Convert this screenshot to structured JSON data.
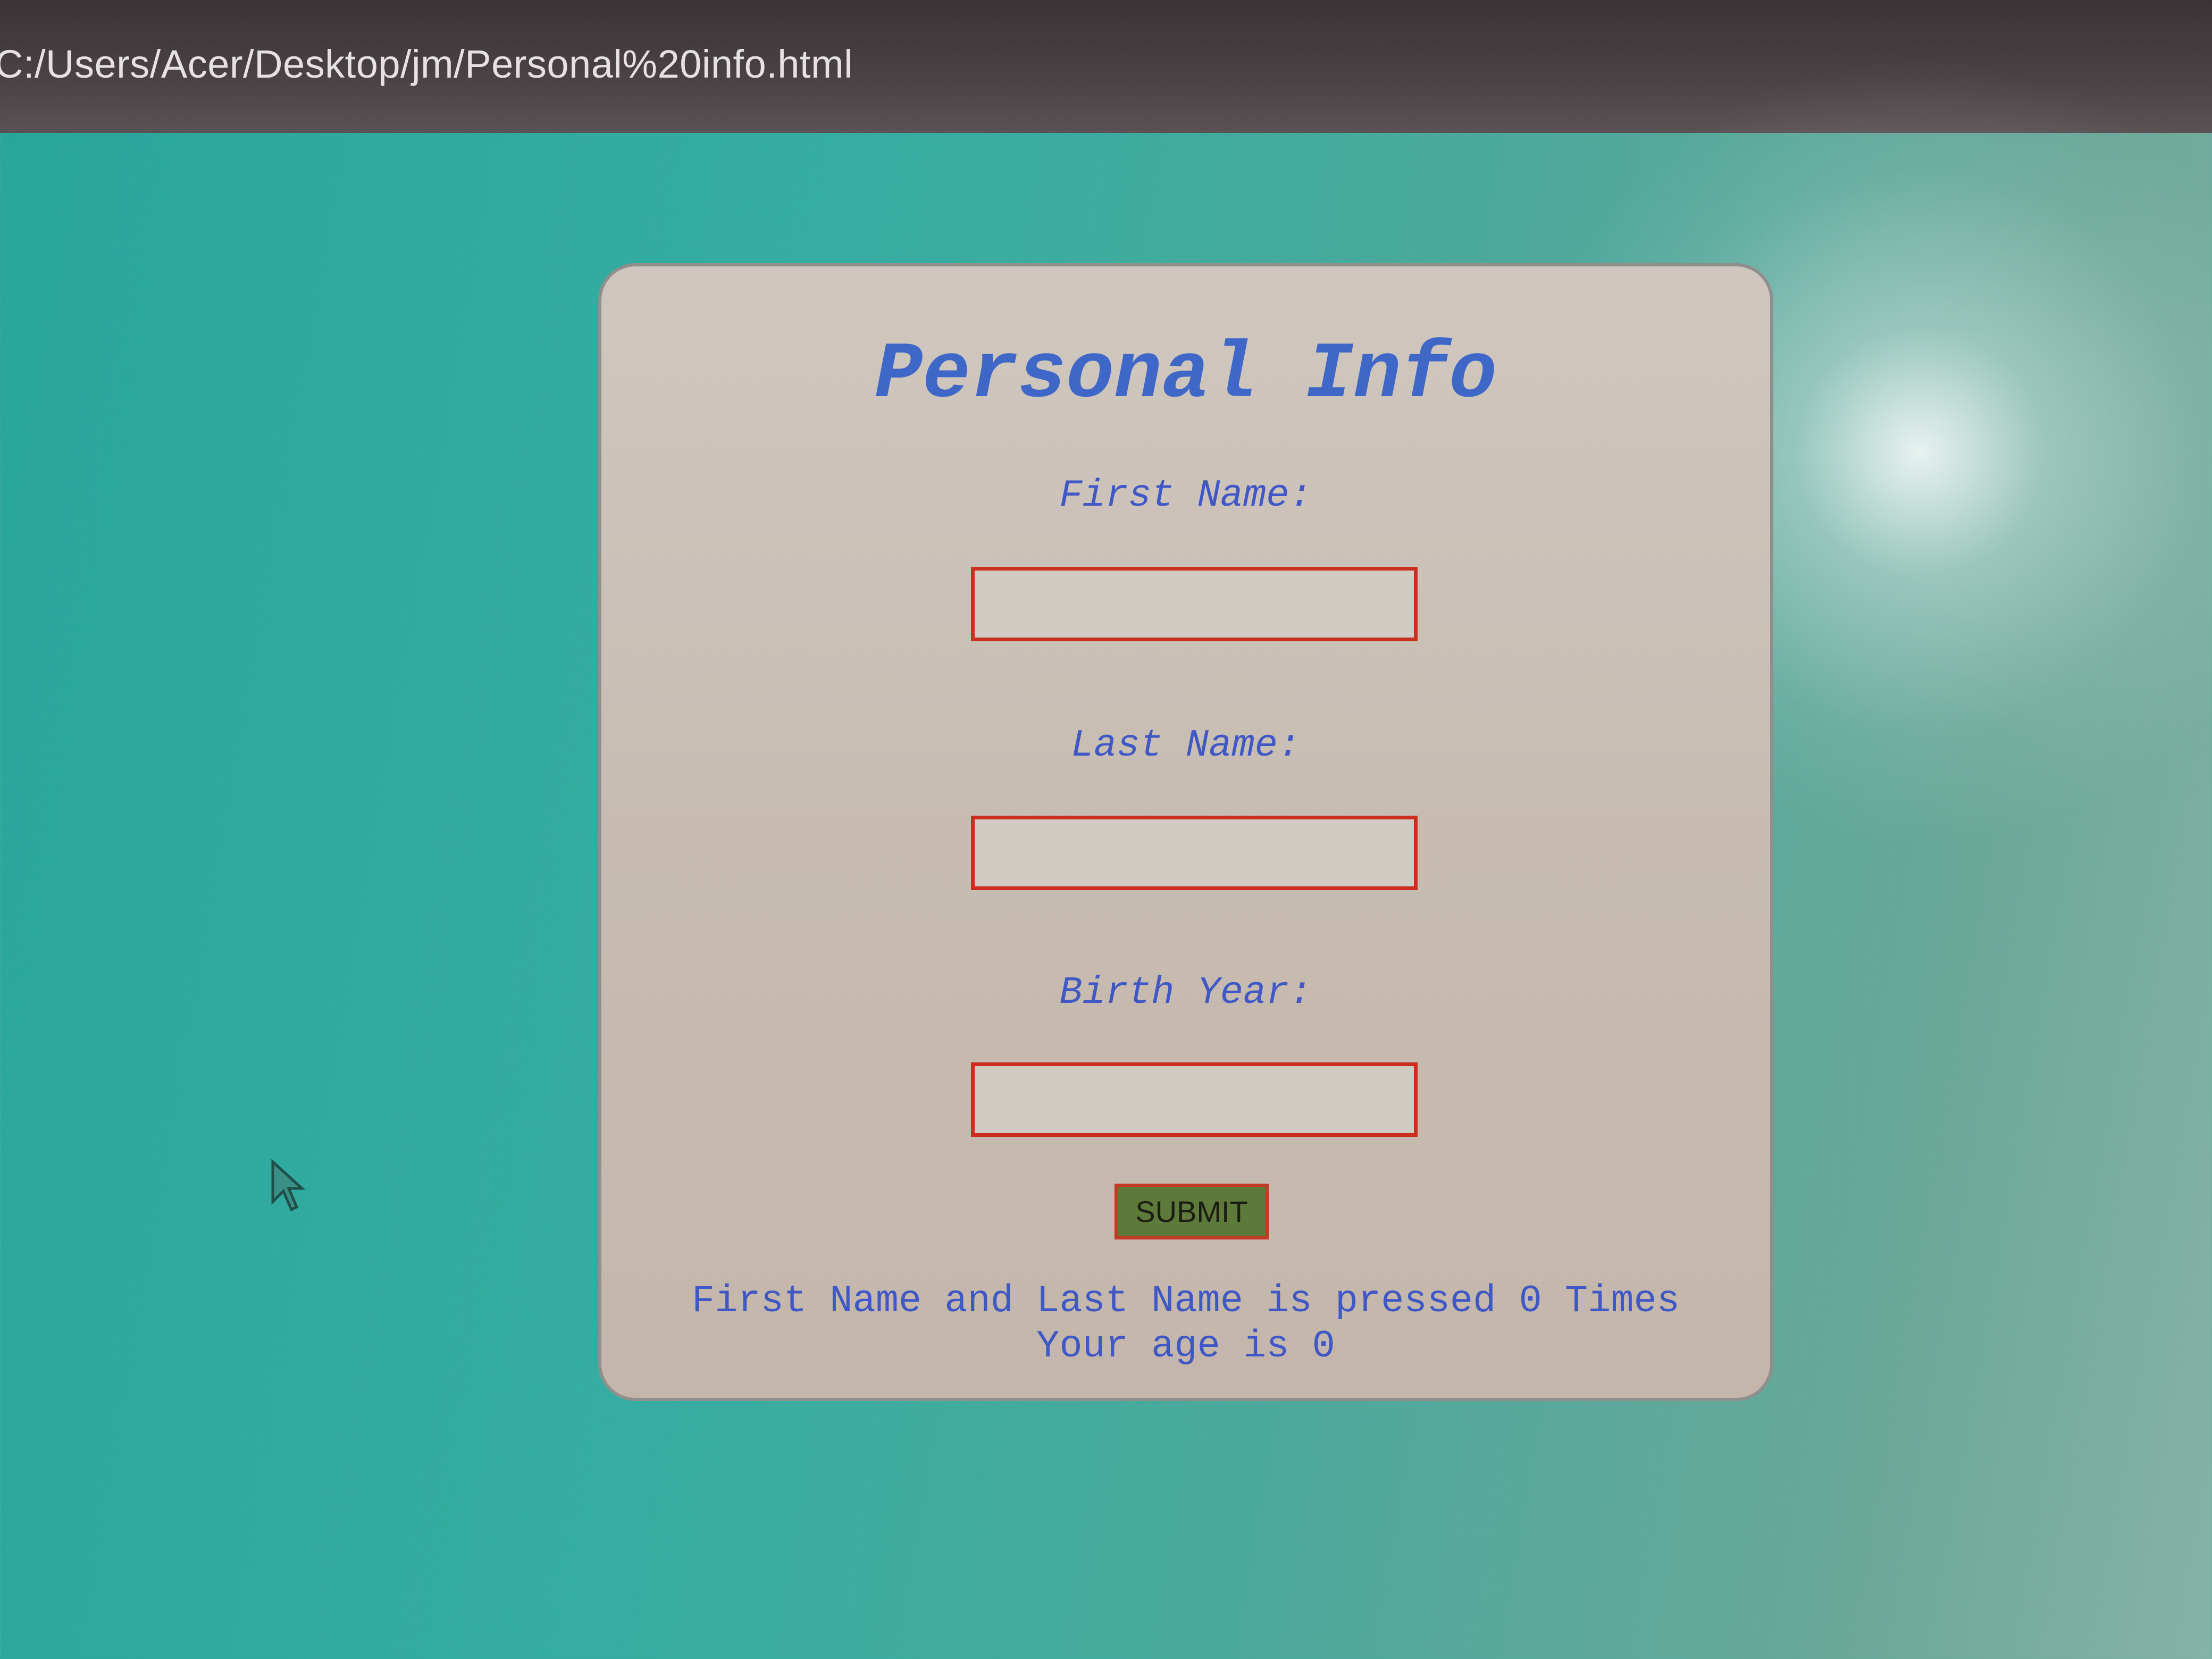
{
  "browser": {
    "address": "C:/Users/Acer/Desktop/jm/Personal%20info.html"
  },
  "form": {
    "title": "Personal Info",
    "fields": [
      {
        "label": "First Name:",
        "value": ""
      },
      {
        "label": "Last Name:",
        "value": ""
      },
      {
        "label": "Birth Year:",
        "value": ""
      }
    ],
    "submit_label": "SUBMIT",
    "result_line1": "First Name and Last Name is pressed 0 Times",
    "result_line2": "Your age is 0"
  },
  "colors": {
    "background": "#2aa59a",
    "card": "#cfc7bf",
    "text_blue": "#3f58c6",
    "input_border": "#c92e1e",
    "button_bg": "#5d7a3b"
  }
}
